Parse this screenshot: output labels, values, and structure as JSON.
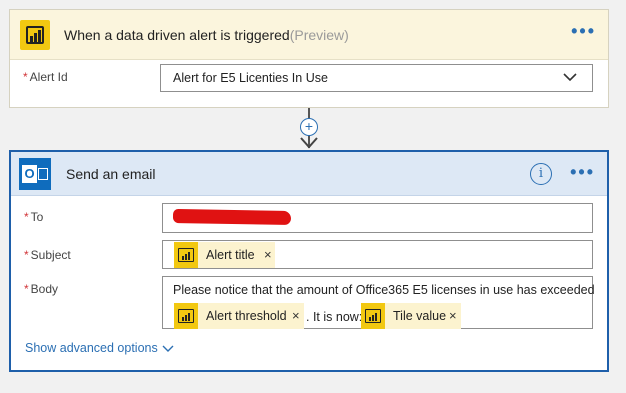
{
  "trigger": {
    "icon": "power-bi-icon",
    "title": "When a data driven alert is triggered",
    "preview": "(Preview)",
    "menu": "•••",
    "alert_id_label": "Alert Id",
    "required_mark": "*",
    "alert_id_value": "Alert for E5 Licenties In Use"
  },
  "connector": {
    "plus": "+"
  },
  "email": {
    "icon": "outlook-icon",
    "icon_letter": "O",
    "title": "Send an email",
    "info": "i",
    "menu": "•••",
    "to_label": "To",
    "subject_label": "Subject",
    "body_label": "Body",
    "required_mark": "*",
    "subject_token": "Alert title",
    "body_text": "Please notice that the amount of Office365 E5 licenses in use has exceeded",
    "body_token_1": "Alert threshold",
    "body_mid_text": ". It is now:",
    "body_token_2": "Tile value",
    "remove": "×",
    "advanced": "Show advanced options"
  },
  "colors": {
    "trigger_header": "#fbf5dd",
    "email_header": "#dde8f5",
    "accent": "#1e5faa",
    "powerbi_yellow": "#f2c811",
    "token_bg": "#fcf3cf",
    "required": "#d13438",
    "redaction": "#e01212"
  }
}
